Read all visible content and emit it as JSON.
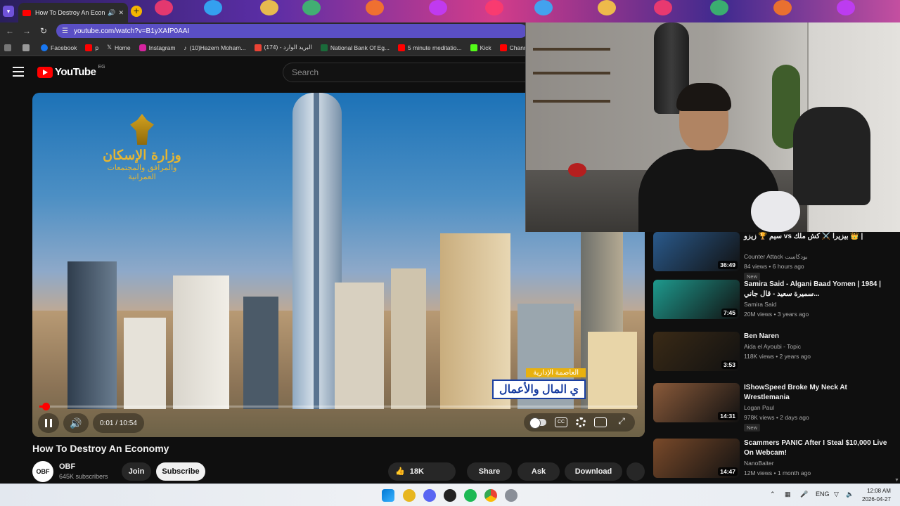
{
  "browser": {
    "tab_title": "How To Destroy An Economy",
    "url": "youtube.com/watch?v=B1yXAfP0AAI",
    "bookmarks": [
      {
        "label": "Facebook",
        "color": "#1877f2"
      },
      {
        "label": "p",
        "color": "#ff0000"
      },
      {
        "label": "Home",
        "color": "#000000"
      },
      {
        "label": "Instagram",
        "color": "#d6249f"
      },
      {
        "label": "(10)Hazem Moham...",
        "color": "#222222"
      },
      {
        "label": "(174) - البريد الوارد",
        "color": "#ea4335"
      },
      {
        "label": "National Bank Of Eg...",
        "color": "#1a6b3a"
      },
      {
        "label": "5 minute meditatio...",
        "color": "#ff0000"
      },
      {
        "label": "Kick",
        "color": "#53fc18"
      },
      {
        "label": "Channe",
        "color": "#ff0000"
      }
    ]
  },
  "youtube": {
    "logo_text": "YouTube",
    "country_code": "EG",
    "search_placeholder": "Search"
  },
  "video": {
    "emblem_line1": "وزارة الإسكان",
    "emblem_line2": "والمرافق والمجتمعات العمرانية",
    "caption_top": "العاصمة الإدارية",
    "caption_main": "ي المال والأعمال",
    "time_current": "0:01",
    "time_total": "10:54",
    "time_display": "0:01 / 10:54",
    "progress_fraction": 0.0015,
    "title": "How To Destroy An Economy",
    "channel_logo": "OBF",
    "channel_name": "OBF",
    "subscribers": "645K subscribers",
    "join_label": "Join",
    "subscribe_label": "Subscribe",
    "likes": "18K",
    "share_label": "Share",
    "ask_label": "Ask",
    "download_label": "Download"
  },
  "recommendations": [
    {
      "title": "سيم 🏆 زيزو vs بيزيرا ⚔️ كش ملك 👑 |",
      "channel": "Counter Attack بودكاست",
      "meta": "84 views • 6 hours ago",
      "badge": "New",
      "duration": "36:49",
      "thumb_color": "#2a5a8c"
    },
    {
      "title": "Samira Said - Algani Baad Yomen | 1984 | سميرة سعيد - قال جاني...",
      "channel": "Samira Said",
      "meta": "20M views • 3 years ago",
      "badge": "",
      "duration": "7:45",
      "thumb_color": "#1e9a8e"
    },
    {
      "title": "Ben Naren",
      "channel": "Aida el Ayoubi - Topic",
      "meta": "118K views • 2 years ago",
      "badge": "",
      "duration": "3:53",
      "thumb_color": "#3a2a16"
    },
    {
      "title": "IShowSpeed Broke My Neck At Wrestlemania",
      "channel": "Logan Paul",
      "meta": "978K views • 2 days ago",
      "badge": "New",
      "duration": "14:31",
      "thumb_color": "#8a5a3a"
    },
    {
      "title": "Scammers PANIC After I Steal $10,000 Live On Webcam!",
      "channel": "NanoBaiter",
      "meta": "12M views • 1 month ago",
      "badge": "",
      "duration": "14:47",
      "thumb_color": "#7a4a2a"
    }
  ],
  "taskbar": {
    "language": "ENG",
    "time": "12:08 AM",
    "date": "2026-04-27"
  }
}
